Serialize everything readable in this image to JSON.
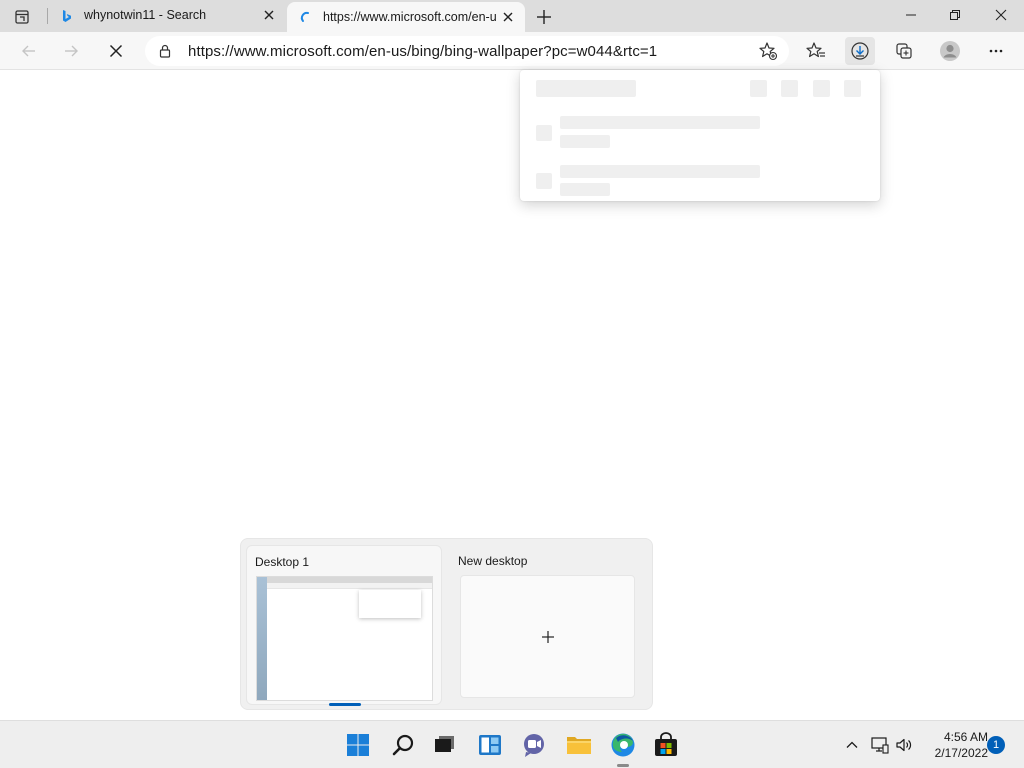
{
  "browser": {
    "tabs": [
      {
        "title": "whynotwin11 - Search",
        "favicon": "bing-icon"
      },
      {
        "title": "https://www.microsoft.com/en-us/bing",
        "favicon": "loading-spinner-icon"
      }
    ],
    "address": "https://www.microsoft.com/en-us/bing/bing-wallpaper?pc=w044&rtc=1"
  },
  "task_view": {
    "desktops": [
      {
        "label": "Desktop 1"
      },
      {
        "label": "New desktop"
      }
    ]
  },
  "taskbar": {
    "time": "4:56 AM",
    "date": "2/17/2022",
    "notification_count": "1"
  },
  "colors": {
    "accent": "#005fb8",
    "edge_blue": "#1e88e5",
    "folder_yellow": "#f8c13a"
  }
}
